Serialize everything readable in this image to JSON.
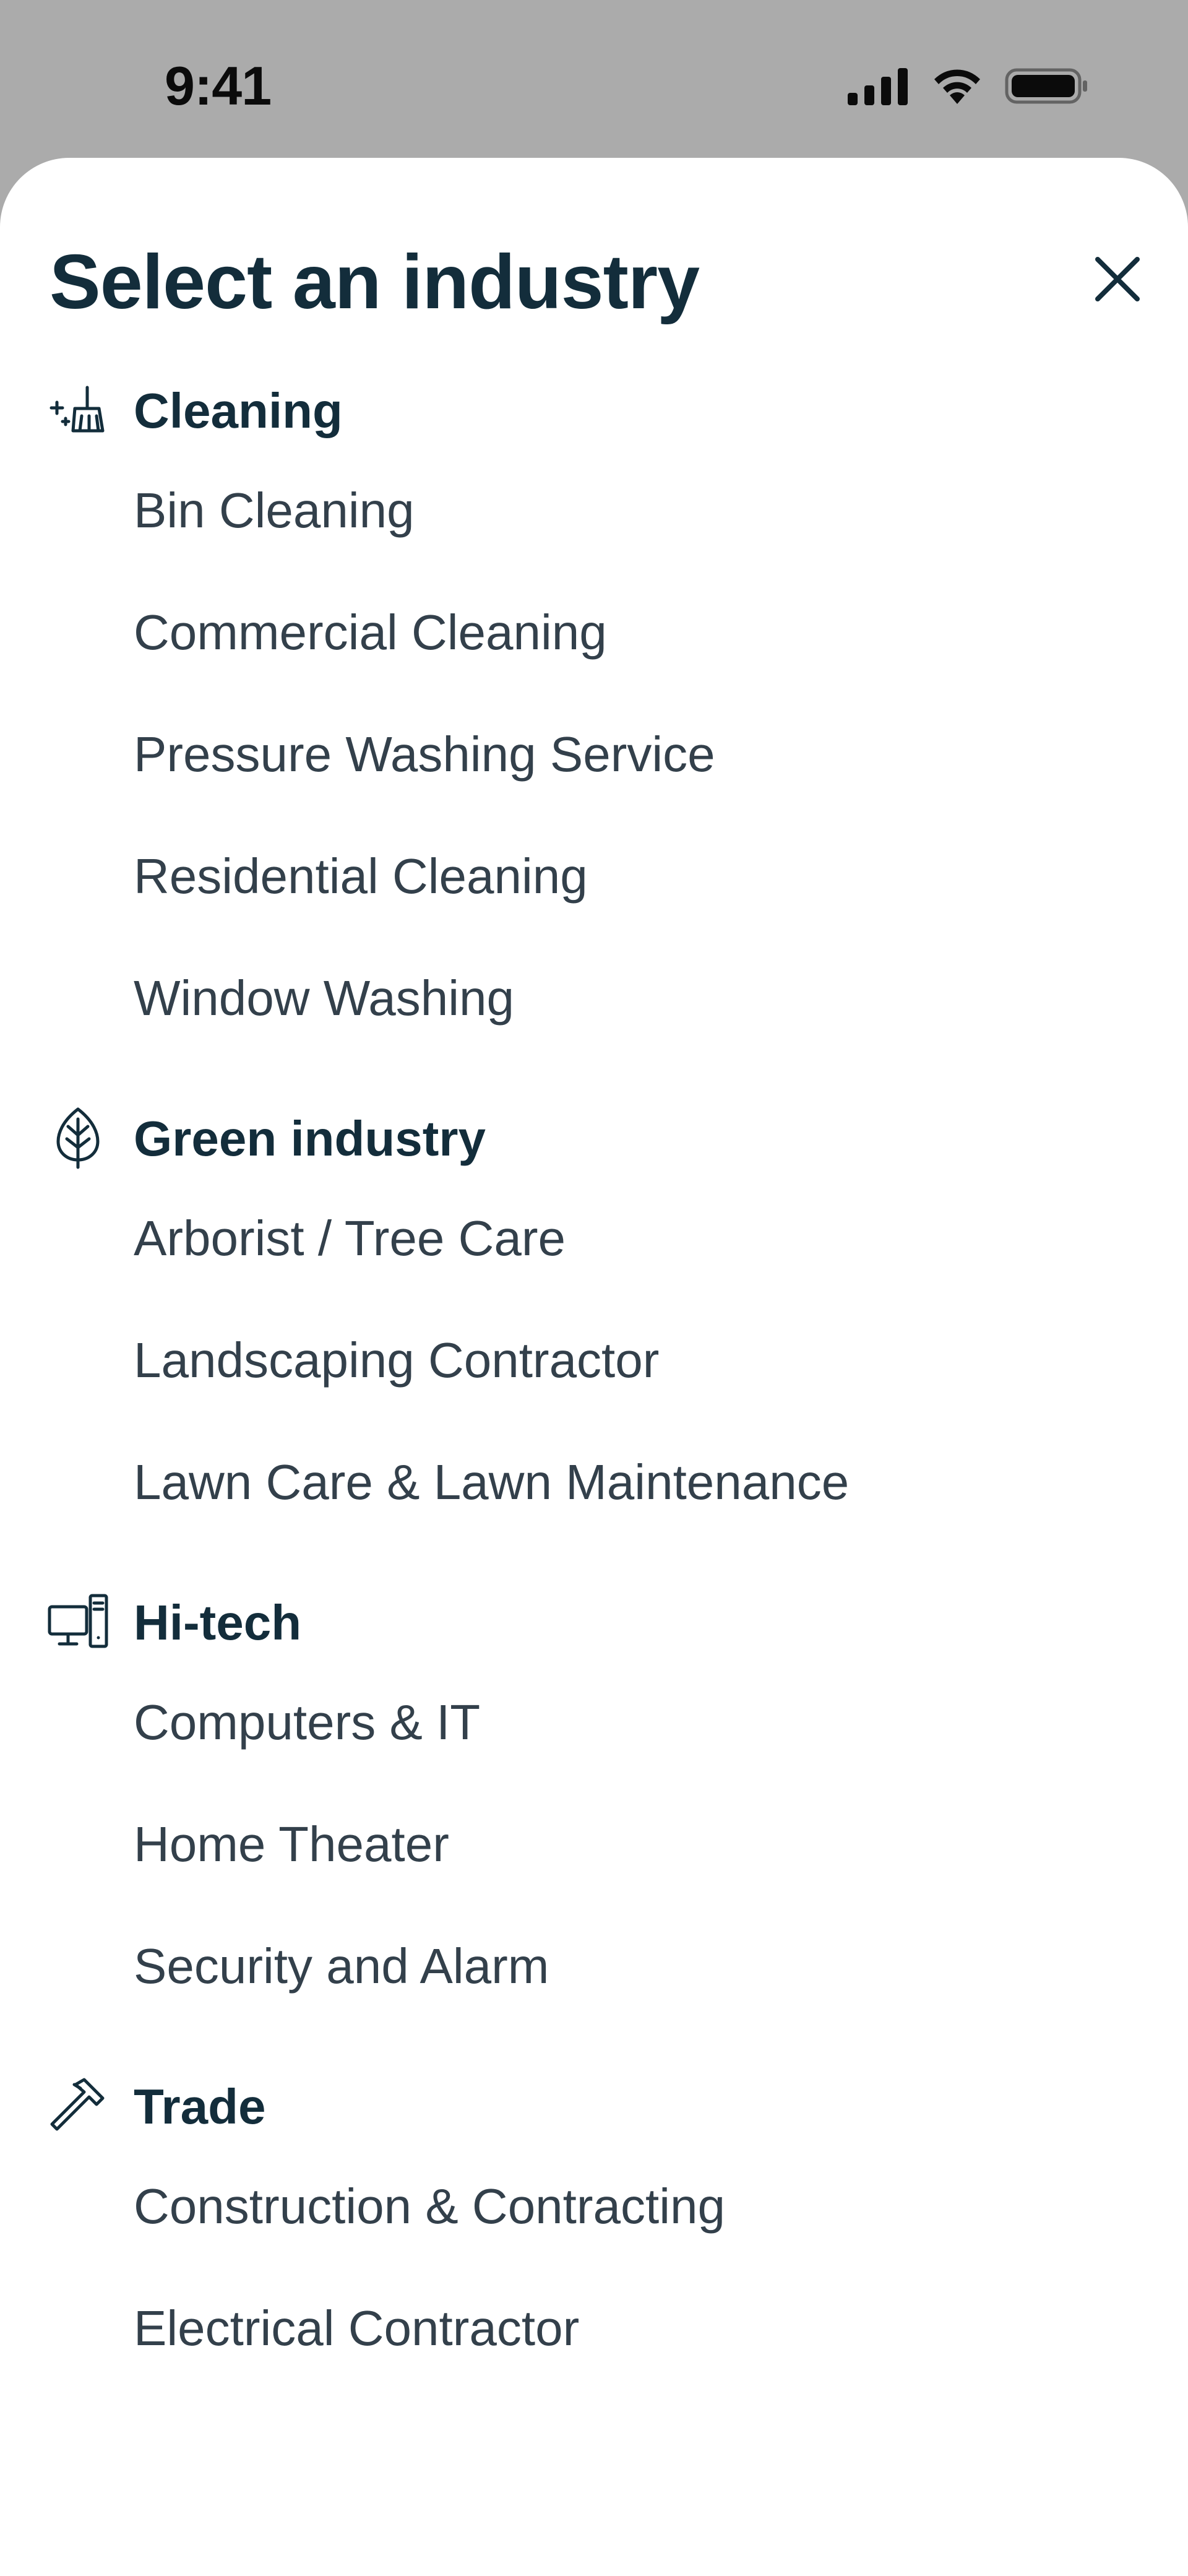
{
  "status_bar": {
    "time": "9:41"
  },
  "sheet": {
    "title": "Select an industry",
    "close_icon": "close-icon"
  },
  "categories": [
    {
      "title": "Cleaning",
      "icon": "broom-sparkle-icon",
      "items": [
        "Bin Cleaning",
        "Commercial Cleaning",
        "Pressure Washing Service",
        "Residential Cleaning",
        "Window Washing"
      ]
    },
    {
      "title": "Green industry",
      "icon": "leaf-icon",
      "items": [
        "Arborist / Tree Care",
        "Landscaping Contractor",
        "Lawn Care & Lawn Maintenance"
      ]
    },
    {
      "title": "Hi-tech",
      "icon": "computer-icon",
      "items": [
        "Computers & IT",
        "Home Theater",
        "Security and Alarm"
      ]
    },
    {
      "title": "Trade",
      "icon": "hammer-icon",
      "items": [
        "Construction & Contracting",
        "Electrical Contractor"
      ]
    }
  ],
  "colors": {
    "backdrop": "#ababab",
    "sheet": "#ffffff",
    "title": "#132d3b",
    "item_text": "#33404b"
  }
}
